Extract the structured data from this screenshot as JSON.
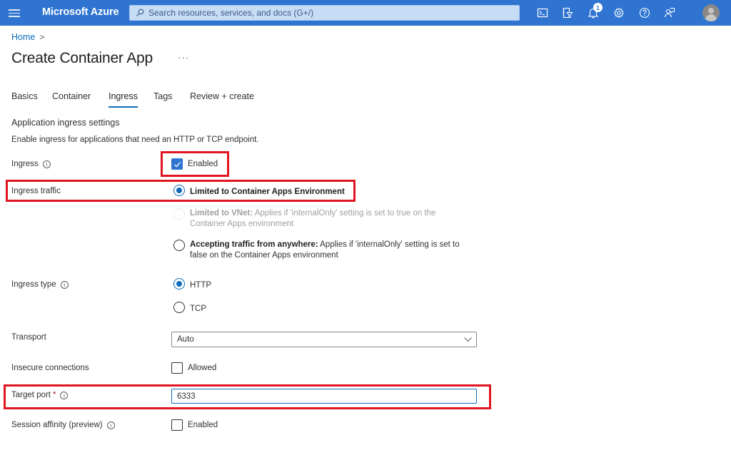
{
  "topbar": {
    "brand": "Microsoft Azure",
    "search_placeholder": "Search resources, services, and docs (G+/)",
    "icons": [
      "cloud-shell-icon",
      "directory-filter-icon",
      "notifications-icon",
      "settings-icon",
      "help-icon",
      "feedback-icon"
    ],
    "notification_count": "1",
    "colors": {
      "bar": "#2f74d0",
      "accent": "#0f6cbd",
      "highlight": "#e0151f"
    }
  },
  "breadcrumb": {
    "home": "Home",
    "separator": ">"
  },
  "page": {
    "title": "Create Container App",
    "more": "···"
  },
  "tabs": [
    {
      "label": "Basics",
      "active": false
    },
    {
      "label": "Container",
      "active": false
    },
    {
      "label": "Ingress",
      "active": true
    },
    {
      "label": "Tags",
      "active": false
    },
    {
      "label": "Review + create",
      "active": false
    }
  ],
  "section": {
    "title": "Application ingress settings",
    "description": "Enable ingress for applications that need an HTTP or TCP endpoint."
  },
  "fields": {
    "ingress": {
      "label": "Ingress",
      "checkbox_label": "Enabled",
      "checked": true
    },
    "ingress_traffic": {
      "label": "Ingress traffic",
      "options": [
        {
          "bold": "Limited to Container Apps Environment",
          "rest": "",
          "selected": true,
          "disabled": false
        },
        {
          "bold": "Limited to VNet:",
          "rest": " Applies if 'internalOnly' setting is set to true on the Container Apps environment",
          "selected": false,
          "disabled": true
        },
        {
          "bold": "Accepting traffic from anywhere:",
          "rest": " Applies if 'internalOnly' setting is set to false on the Container Apps environment",
          "selected": false,
          "disabled": false
        }
      ]
    },
    "ingress_type": {
      "label": "Ingress type",
      "options": [
        {
          "label": "HTTP",
          "selected": true
        },
        {
          "label": "TCP",
          "selected": false
        }
      ]
    },
    "transport": {
      "label": "Transport",
      "value": "Auto"
    },
    "insecure_connections": {
      "label": "Insecure connections",
      "checkbox_label": "Allowed",
      "checked": false
    },
    "target_port": {
      "label": "Target port",
      "required_mark": "*",
      "value": "6333"
    },
    "session_affinity": {
      "label": "Session affinity (preview)",
      "checkbox_label": "Enabled",
      "checked": false
    }
  }
}
